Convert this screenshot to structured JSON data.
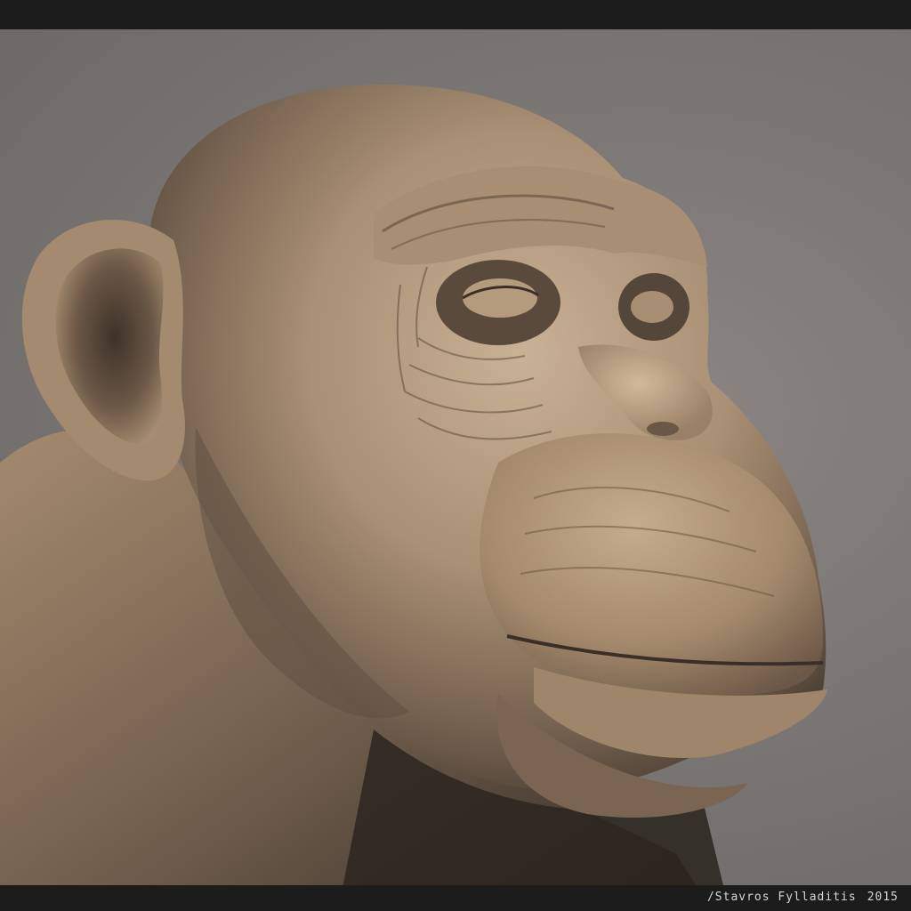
{
  "image": {
    "subject": "chimpanzee-bust-sculpt",
    "colors": {
      "background": "#7b7774",
      "skin": "#b39a7e",
      "skin_shadow": "#4a3f35",
      "frame_bars": "#1b1b1b",
      "credit_text": "#d6d6d6"
    }
  },
  "credit": {
    "author": "/Stavros Fylladitis",
    "year": "2015"
  }
}
